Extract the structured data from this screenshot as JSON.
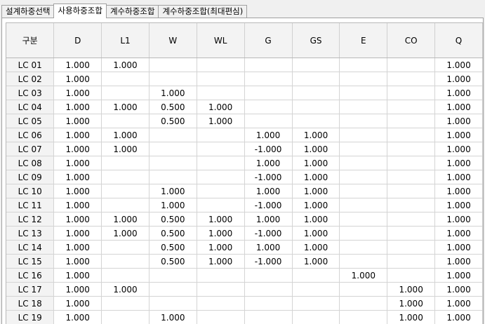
{
  "tabs": [
    {
      "label": "설계하중선택",
      "active": false
    },
    {
      "label": "사용하중조합",
      "active": true
    },
    {
      "label": "계수하중조합",
      "active": false
    },
    {
      "label": "계수하중조합(최대편심)",
      "active": false
    }
  ],
  "table": {
    "columns": [
      "구분",
      "D",
      "L1",
      "W",
      "WL",
      "G",
      "GS",
      "E",
      "CO",
      "Q"
    ],
    "rows": [
      [
        "LC 01",
        "1.000",
        "1.000",
        "",
        "",
        "",
        "",
        "",
        "",
        "1.000"
      ],
      [
        "LC 02",
        "1.000",
        "",
        "",
        "",
        "",
        "",
        "",
        "",
        "1.000"
      ],
      [
        "LC 03",
        "1.000",
        "",
        "1.000",
        "",
        "",
        "",
        "",
        "",
        "1.000"
      ],
      [
        "LC 04",
        "1.000",
        "1.000",
        "0.500",
        "1.000",
        "",
        "",
        "",
        "",
        "1.000"
      ],
      [
        "LC 05",
        "1.000",
        "",
        "0.500",
        "1.000",
        "",
        "",
        "",
        "",
        "1.000"
      ],
      [
        "LC 06",
        "1.000",
        "1.000",
        "",
        "",
        "1.000",
        "1.000",
        "",
        "",
        "1.000"
      ],
      [
        "LC 07",
        "1.000",
        "1.000",
        "",
        "",
        "-1.000",
        "1.000",
        "",
        "",
        "1.000"
      ],
      [
        "LC 08",
        "1.000",
        "",
        "",
        "",
        "1.000",
        "1.000",
        "",
        "",
        "1.000"
      ],
      [
        "LC 09",
        "1.000",
        "",
        "",
        "",
        "-1.000",
        "1.000",
        "",
        "",
        "1.000"
      ],
      [
        "LC 10",
        "1.000",
        "",
        "1.000",
        "",
        "1.000",
        "1.000",
        "",
        "",
        "1.000"
      ],
      [
        "LC 11",
        "1.000",
        "",
        "1.000",
        "",
        "-1.000",
        "1.000",
        "",
        "",
        "1.000"
      ],
      [
        "LC 12",
        "1.000",
        "1.000",
        "0.500",
        "1.000",
        "1.000",
        "1.000",
        "",
        "",
        "1.000"
      ],
      [
        "LC 13",
        "1.000",
        "1.000",
        "0.500",
        "1.000",
        "-1.000",
        "1.000",
        "",
        "",
        "1.000"
      ],
      [
        "LC 14",
        "1.000",
        "",
        "0.500",
        "1.000",
        "1.000",
        "1.000",
        "",
        "",
        "1.000"
      ],
      [
        "LC 15",
        "1.000",
        "",
        "0.500",
        "1.000",
        "-1.000",
        "1.000",
        "",
        "",
        "1.000"
      ],
      [
        "LC 16",
        "1.000",
        "",
        "",
        "",
        "",
        "",
        "1.000",
        "",
        "1.000"
      ],
      [
        "LC 17",
        "1.000",
        "1.000",
        "",
        "",
        "",
        "",
        "",
        "1.000",
        "1.000"
      ],
      [
        "LC 18",
        "1.000",
        "",
        "",
        "",
        "",
        "",
        "",
        "1.000",
        "1.000"
      ],
      [
        "LC 19",
        "1.000",
        "",
        "1.000",
        "",
        "",
        "",
        "",
        "1.000",
        "1.000"
      ]
    ]
  }
}
